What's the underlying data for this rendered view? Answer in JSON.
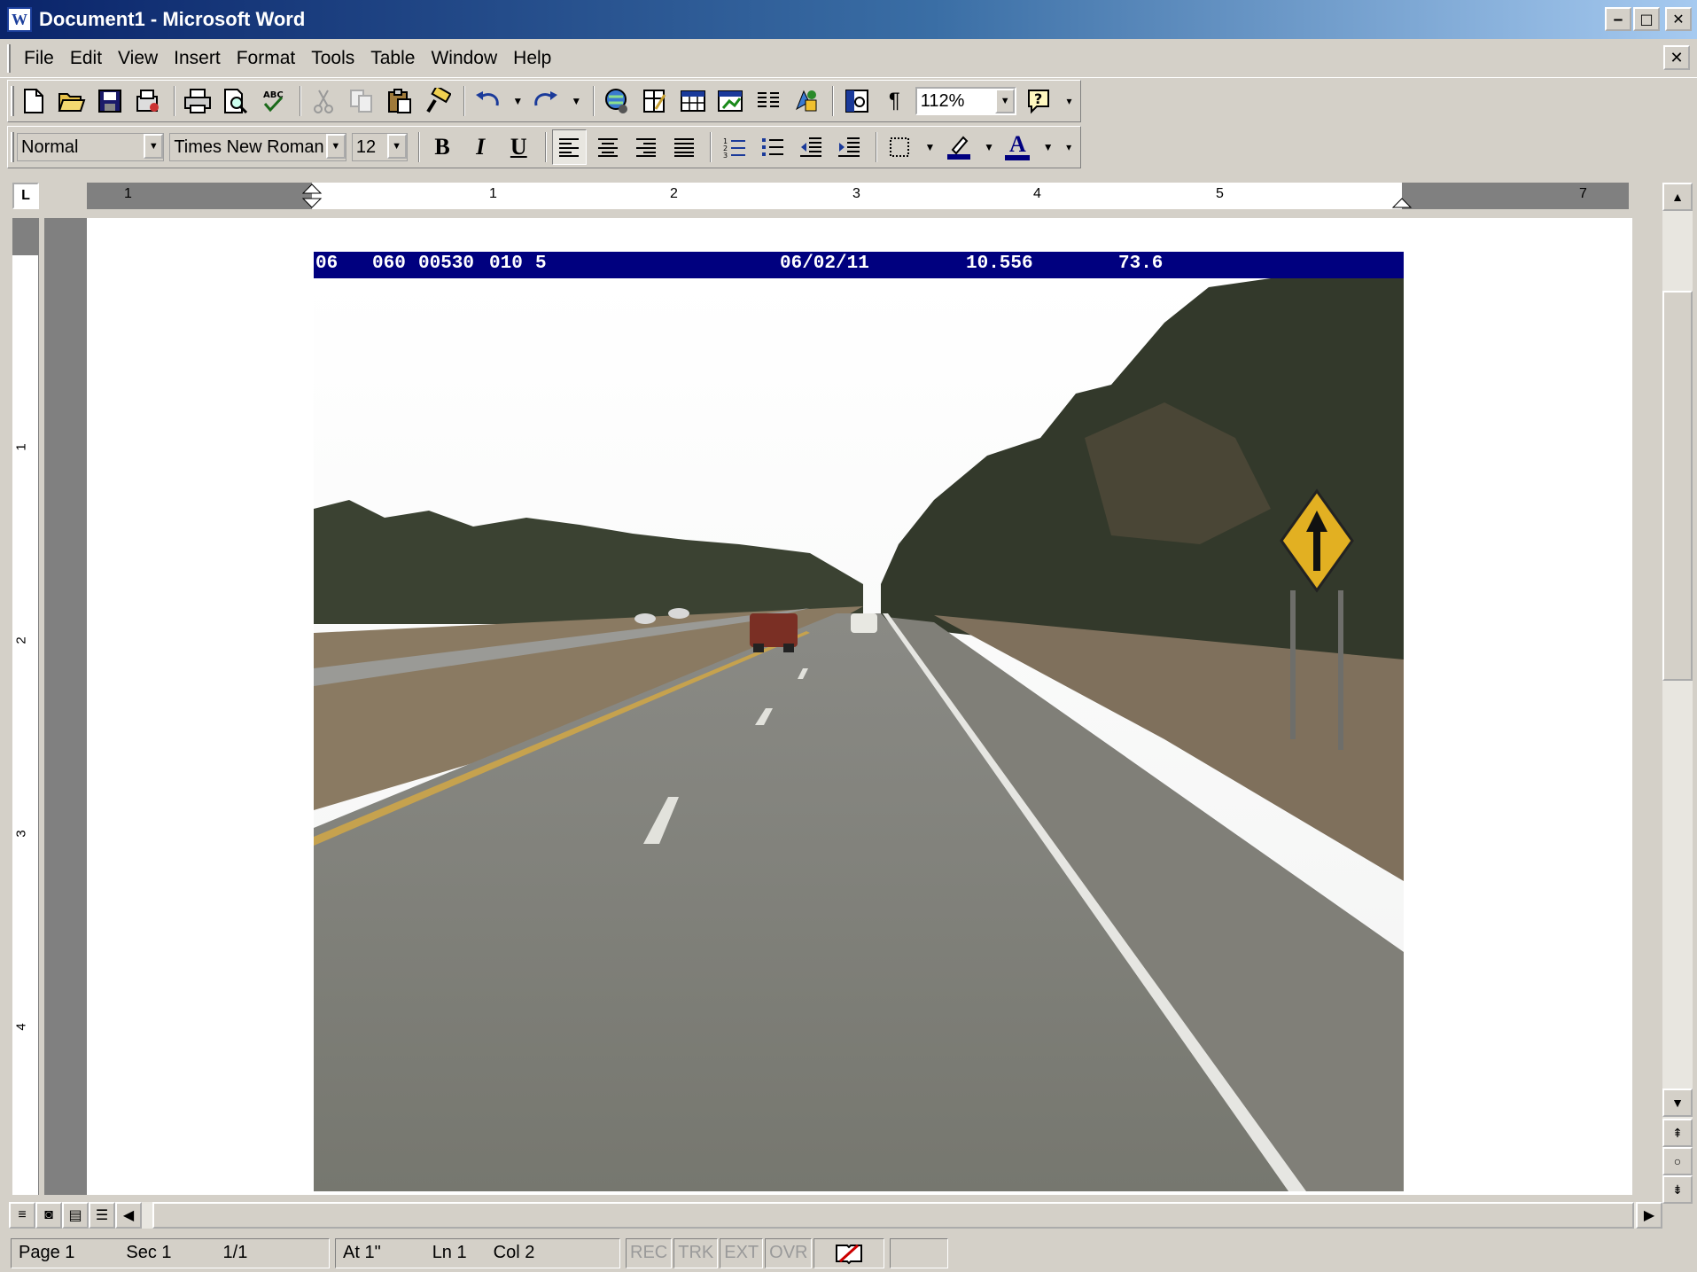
{
  "window": {
    "title": "Document1 - Microsoft Word",
    "app_icon_letter": "W",
    "minimize": "‒",
    "maximize": "□",
    "close": "✕",
    "doc_close": "✕"
  },
  "menu": [
    "File",
    "Edit",
    "View",
    "Insert",
    "Format",
    "Tools",
    "Table",
    "Window",
    "Help"
  ],
  "toolbar": {
    "zoom": "112%",
    "style": "Normal",
    "font": "Times New Roman",
    "size": "12",
    "bold": "B",
    "italic": "I",
    "underline": "U",
    "pilcrow": "¶",
    "font_color_letter": "A"
  },
  "ruler": {
    "corner": "L",
    "h_labels": [
      "1",
      "1",
      "2",
      "3",
      "4",
      "5",
      "7"
    ],
    "v_labels": [
      "1",
      "2",
      "3",
      "4"
    ]
  },
  "image_header": {
    "f1": "06",
    "f2": "060",
    "f3": "00530",
    "f4": "010",
    "f5": "5",
    "date": "06/02/11",
    "v1": "10.556",
    "v2": "73.6"
  },
  "status": {
    "page": "Page 1",
    "sec": "Sec 1",
    "pages": "1/1",
    "at": "At 1\"",
    "ln": "Ln 1",
    "col": "Col 2",
    "rec": "REC",
    "trk": "TRK",
    "ext": "EXT",
    "ovr": "OVR"
  },
  "colors": {
    "title_gradient_start": "#0a246a",
    "image_header_bg": "#00007f",
    "chrome": "#d4d0c8"
  }
}
